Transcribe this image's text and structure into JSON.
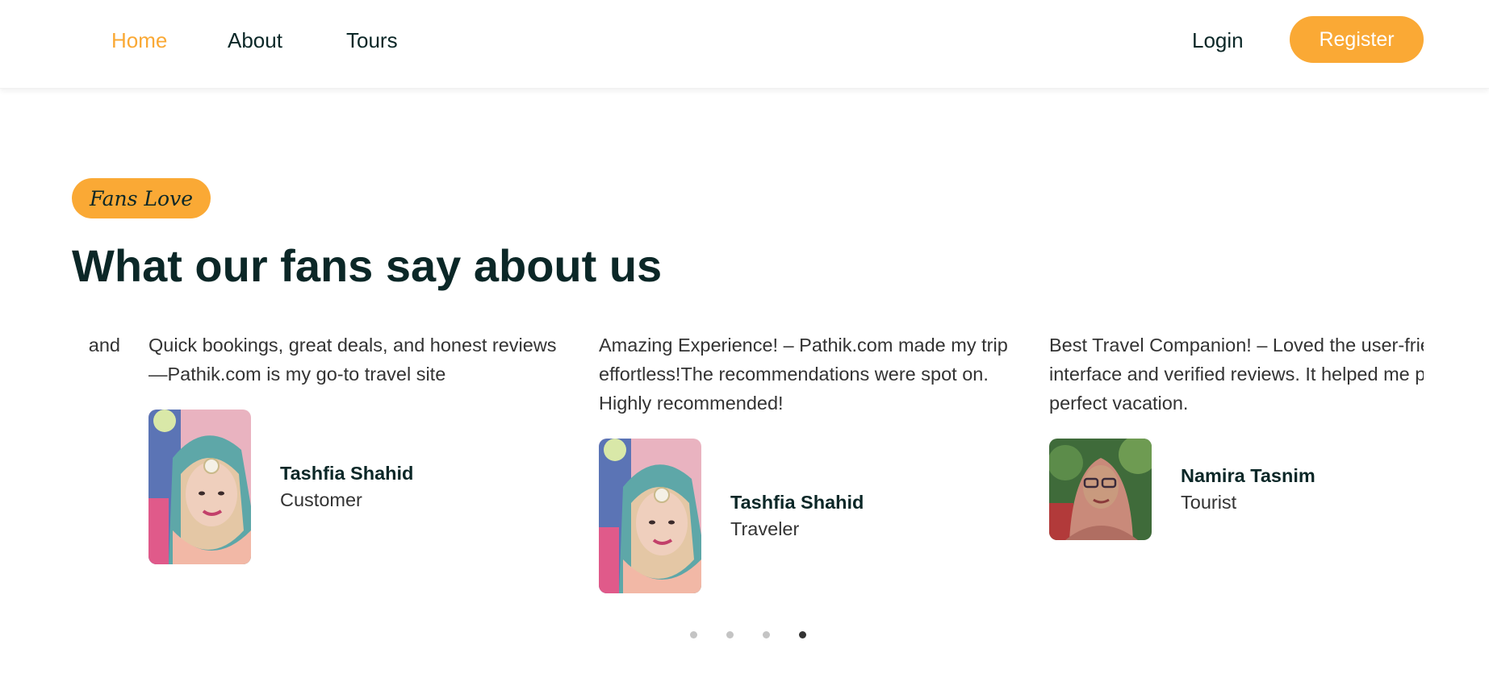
{
  "nav": {
    "links": [
      {
        "label": "Home",
        "active": true
      },
      {
        "label": "About",
        "active": false
      },
      {
        "label": "Tours",
        "active": false
      }
    ],
    "login_label": "Login",
    "register_label": "Register"
  },
  "section": {
    "tag": "Fans Love",
    "title": "What our fans say about us"
  },
  "testimonials": [
    {
      "quote": "and",
      "name": "",
      "role": ""
    },
    {
      "quote": "Quick bookings, great deals, and honest reviews—Pathik.com is my go-to travel site",
      "name": "Tashfia Shahid",
      "role": "Customer",
      "avatar": "woman-hijab-photo"
    },
    {
      "quote": "Amazing Experience! – Pathik.com made my trip effortless!The recommendations were spot on. Highly recommended!",
      "name": "Tashfia Shahid",
      "role": "Traveler",
      "avatar": "woman-hijab-photo"
    },
    {
      "quote": "Best Travel Companion! – Loved the user-friendly interface and verified reviews. It helped me plan a perfect vacation.",
      "name": "Namira Tasnim",
      "role": "Tourist",
      "avatar": "woman-hijab-glasses-photo"
    }
  ],
  "carousel": {
    "dots": 4,
    "active_dot": 4
  },
  "colors": {
    "accent": "#faa935",
    "heading": "#0b2727",
    "text": "#333333"
  }
}
